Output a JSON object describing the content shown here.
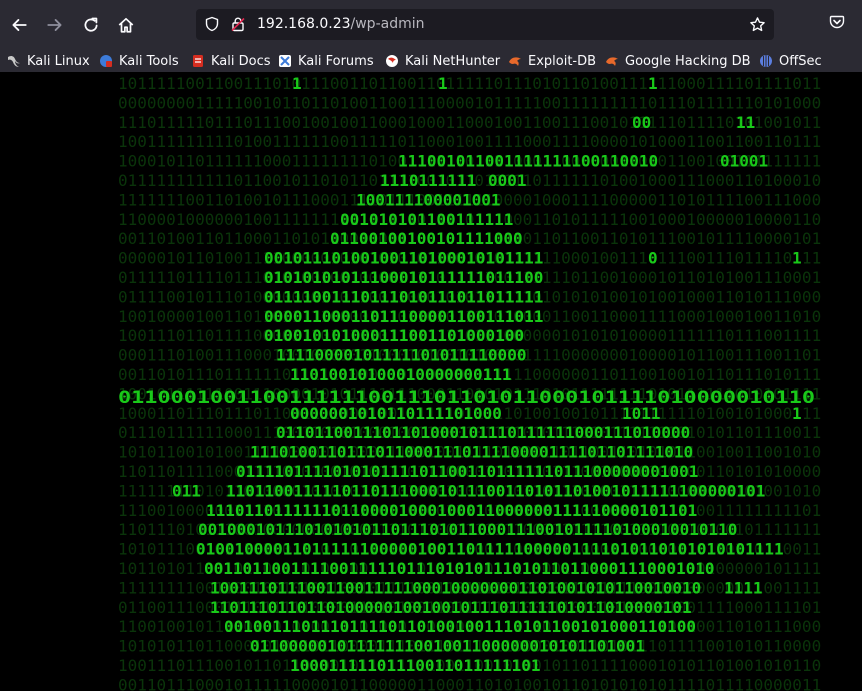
{
  "toolbar": {
    "url_host": "192.168.0.23",
    "url_path": "/wp-admin",
    "back_icon": "arrow-left",
    "forward_icon": "arrow-right",
    "reload_icon": "reload",
    "home_icon": "home",
    "shield_icon": "tracking-shield",
    "lock_icon": "insecure-lock",
    "star_icon": "star",
    "pocket_icon": "pocket"
  },
  "bookmarks": [
    {
      "label": "Kali Linux",
      "icon": "kali-dragon",
      "color": "#c8c8c8"
    },
    {
      "label": "Kali Tools",
      "icon": "kali-tools",
      "color": "#3d7bd9"
    },
    {
      "label": "Kali Docs",
      "icon": "kali-docs",
      "color": "#d62d20"
    },
    {
      "label": "Kali Forums",
      "icon": "kali-forums",
      "color": "#3d7bd9"
    },
    {
      "label": "Kali NetHunter",
      "icon": "nethunter",
      "color": "#d62d20"
    },
    {
      "label": "Exploit-DB",
      "icon": "exploit-db",
      "color": "#e8692b"
    },
    {
      "label": "Google Hacking DB",
      "icon": "ghdb",
      "color": "#e8692b"
    },
    {
      "label": "OffSec",
      "icon": "offsec",
      "color": "#5b7ee0"
    }
  ],
  "page": {
    "background": "#000000",
    "digit_color": "#19c919",
    "dim_digit_color": "#0b3a0b",
    "banner_text": "01100010011001111110011101101011000101111010000010110"
  }
}
